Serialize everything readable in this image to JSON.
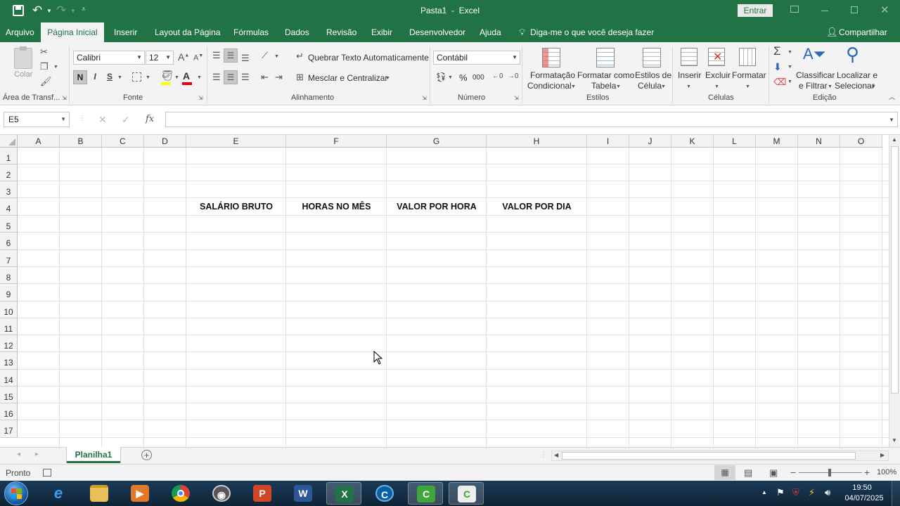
{
  "window": {
    "title": "Pasta1  -  Excel",
    "signin_label": "Entrar"
  },
  "menu": {
    "tabs": [
      "Arquivo",
      "Página Inicial",
      "Inserir",
      "Layout da Página",
      "Fórmulas",
      "Dados",
      "Revisão",
      "Exibir",
      "Desenvolvedor",
      "Ajuda"
    ],
    "active_tab": "Página Inicial",
    "tell_me": "Diga-me o que você deseja fazer",
    "share": "Compartilhar"
  },
  "ribbon": {
    "clipboard": {
      "paste": "Colar",
      "label": "Área de Transf..."
    },
    "font": {
      "name": "Calibri",
      "size": "12",
      "bold": "N",
      "italic": "I",
      "underline": "S",
      "label": "Fonte"
    },
    "alignment": {
      "wrap": "Quebrar Texto Automaticamente",
      "merge": "Mesclar e Centralizar",
      "label": "Alinhamento"
    },
    "number": {
      "format": "Contábil",
      "percent": "%",
      "thousands": "000",
      "label": "Número"
    },
    "styles": {
      "conditional": [
        "Formatação",
        "Condicional"
      ],
      "table": [
        "Formatar como",
        "Tabela"
      ],
      "cell": [
        "Estilos de",
        "Célula"
      ],
      "label": "Estilos"
    },
    "cells": {
      "insert": "Inserir",
      "delete": "Excluir",
      "format": "Formatar",
      "label": "Células"
    },
    "editing": {
      "sort": [
        "Classificar",
        "e Filtrar"
      ],
      "find": [
        "Localizar e",
        "Selecionar"
      ],
      "label": "Edição"
    }
  },
  "formula_bar": {
    "name_box": "E5",
    "fx": "fx",
    "value": ""
  },
  "sheet": {
    "columns": [
      "A",
      "B",
      "C",
      "D",
      "E",
      "F",
      "G",
      "H",
      "I",
      "J",
      "K",
      "L",
      "M",
      "N",
      "O"
    ],
    "rows": [
      "1",
      "2",
      "3",
      "4",
      "5",
      "6",
      "7",
      "8",
      "9",
      "10",
      "11",
      "12",
      "13",
      "14",
      "15",
      "16",
      "17"
    ],
    "cells": {
      "E4": "SALÁRIO BRUTO",
      "F4": "HORAS NO MÊS",
      "G4": "VALOR POR HORA",
      "H4": "VALOR POR DIA"
    },
    "active_cell": "E5"
  },
  "sheet_tabs": {
    "active": "Planilha1"
  },
  "status": {
    "ready": "Pronto",
    "zoom": "100%"
  },
  "taskbar": {
    "time": "19:50",
    "date": "04/07/2025"
  },
  "colors": {
    "excel_green": "#217346"
  }
}
